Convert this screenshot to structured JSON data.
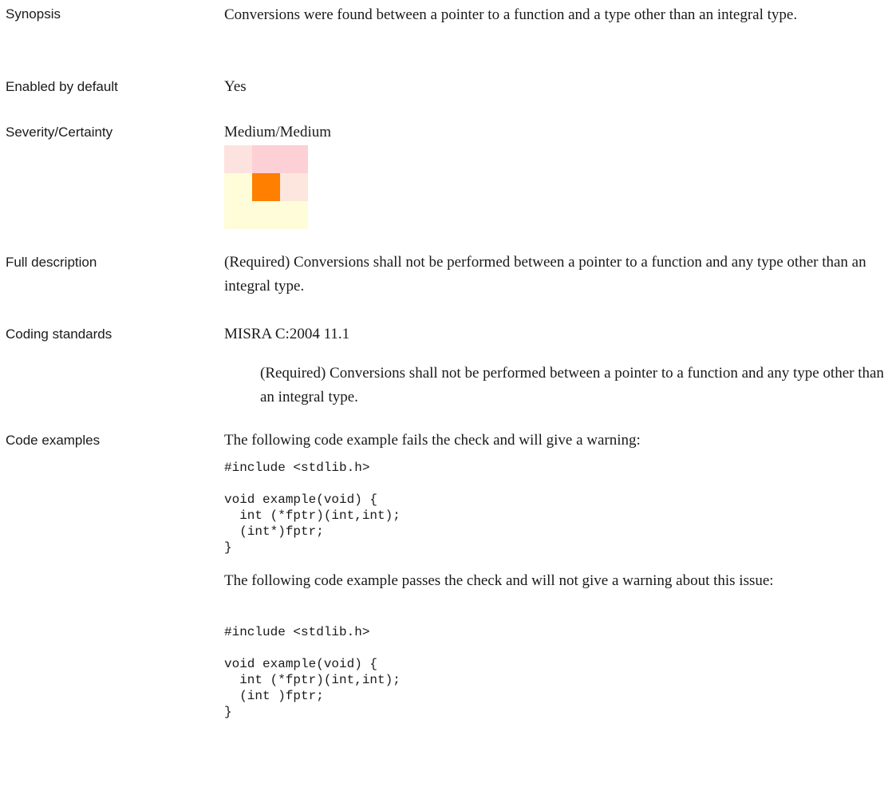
{
  "fields": {
    "synopsis": {
      "label": "Synopsis",
      "value": "Conversions were found between a pointer to a function and a type other than an integral type."
    },
    "enabled_by_default": {
      "label": "Enabled by default",
      "value": "Yes"
    },
    "severity_certainty": {
      "label": "Severity/Certainty",
      "value": "Medium/Medium",
      "matrix": {
        "selected_severity": "Medium",
        "selected_certainty": "Medium",
        "colors": {
          "top": "#fde3df",
          "top_mid": "#fdd0d6",
          "mid_right": "#fde6dd",
          "selected": "#ff7f00",
          "bottom": "#fffcd9"
        }
      }
    },
    "full_description": {
      "label": "Full description",
      "value": " (Required) Conversions shall not be performed between a pointer to a function and any type other than an integral type."
    },
    "coding_standards": {
      "label": "Coding standards",
      "standard": "MISRA C:2004 11.1",
      "standard_text": "(Required) Conversions shall not be performed between a pointer to a function and any type other than an integral type."
    },
    "code_examples": {
      "label": "Code examples",
      "fail_intro": "The following code example fails the check and will give a warning:",
      "fail_code": "#include <stdlib.h>\n\nvoid example(void) {\n  int (*fptr)(int,int);\n  (int*)fptr;\n}",
      "pass_intro": "The following code example passes the check and will not give a warning about this issue:",
      "pass_code": "#include <stdlib.h>\n\nvoid example(void) {\n  int (*fptr)(int,int);\n  (int )fptr;\n}"
    }
  }
}
